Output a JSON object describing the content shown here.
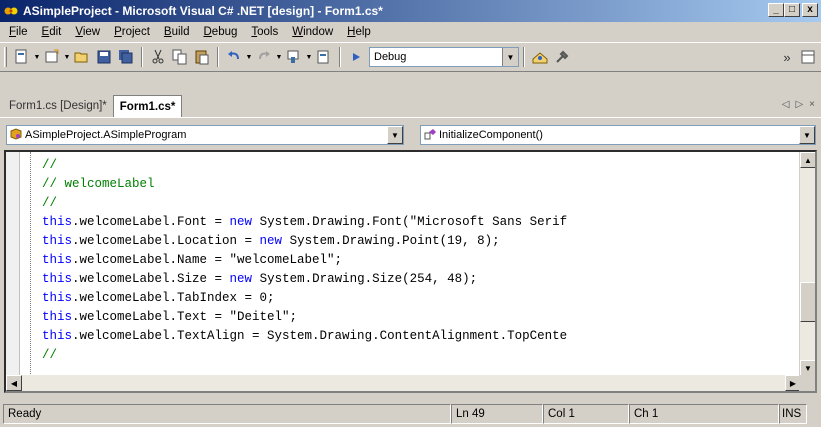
{
  "window": {
    "title": "ASimpleProject - Microsoft Visual C# .NET [design] - Form1.cs*",
    "minimize_label": "_",
    "maximize_label": "□",
    "close_label": "x"
  },
  "menu": [
    {
      "key": "F",
      "rest": "ile"
    },
    {
      "key": "E",
      "rest": "dit"
    },
    {
      "key": "V",
      "rest": "iew"
    },
    {
      "key": "P",
      "rest": "roject"
    },
    {
      "key": "B",
      "rest": "uild"
    },
    {
      "key": "D",
      "rest": "ebug"
    },
    {
      "key": "T",
      "rest": "ools"
    },
    {
      "key": "W",
      "rest": "indow"
    },
    {
      "key": "H",
      "rest": "elp"
    }
  ],
  "toolbar": {
    "configuration": "Debug",
    "icons": [
      "new-project-icon",
      "add-item-icon",
      "open-icon",
      "save-icon",
      "save-all-icon",
      "cut-icon",
      "copy-icon",
      "paste-icon",
      "undo-icon",
      "redo-icon",
      "navigate-icon",
      "start-icon",
      "find-icon",
      "solution-explorer-icon"
    ]
  },
  "tabs": [
    {
      "label": "Form1.cs [Design]*",
      "active": false
    },
    {
      "label": "Form1.cs*",
      "active": true
    }
  ],
  "tab_nav": {
    "prev": "◁",
    "next": "▷",
    "close": "×"
  },
  "combos": {
    "class_selector": "ASimpleProject.ASimpleProgram",
    "member_selector": "InitializeComponent()"
  },
  "code_lines": [
    [
      {
        "t": "//",
        "c": "cm"
      }
    ],
    [
      {
        "t": "// welcomeLabel",
        "c": "cm"
      }
    ],
    [
      {
        "t": "//",
        "c": "cm"
      }
    ],
    [
      {
        "t": "this",
        "c": "kw"
      },
      {
        "t": ".welcomeLabel.Font = ",
        "c": ""
      },
      {
        "t": "new",
        "c": "kw"
      },
      {
        "t": " System.Drawing.Font(\"Microsoft Sans Serif",
        "c": ""
      }
    ],
    [
      {
        "t": "this",
        "c": "kw"
      },
      {
        "t": ".welcomeLabel.Location = ",
        "c": ""
      },
      {
        "t": "new",
        "c": "kw"
      },
      {
        "t": " System.Drawing.Point(19, 8);",
        "c": ""
      }
    ],
    [
      {
        "t": "this",
        "c": "kw"
      },
      {
        "t": ".welcomeLabel.Name = \"welcomeLabel\";",
        "c": ""
      }
    ],
    [
      {
        "t": "this",
        "c": "kw"
      },
      {
        "t": ".welcomeLabel.Size = ",
        "c": ""
      },
      {
        "t": "new",
        "c": "kw"
      },
      {
        "t": " System.Drawing.Size(254, 48);",
        "c": ""
      }
    ],
    [
      {
        "t": "this",
        "c": "kw"
      },
      {
        "t": ".welcomeLabel.TabIndex = 0;",
        "c": ""
      }
    ],
    [
      {
        "t": "this",
        "c": "kw"
      },
      {
        "t": ".welcomeLabel.Text = \"Deitel\";",
        "c": ""
      }
    ],
    [
      {
        "t": "this",
        "c": "kw"
      },
      {
        "t": ".welcomeLabel.TextAlign = System.Drawing.ContentAlignment.TopCente",
        "c": ""
      }
    ],
    [
      {
        "t": "//",
        "c": "cm"
      }
    ]
  ],
  "status": {
    "message": "Ready",
    "line": "Ln 49",
    "col": "Col 1",
    "ch": "Ch 1",
    "mode": "INS"
  },
  "colors": {
    "title_start": "#0a246a",
    "title_end": "#a6caf0",
    "keyword": "#0000ff",
    "comment": "#008000",
    "chrome": "#d4d0c8"
  }
}
